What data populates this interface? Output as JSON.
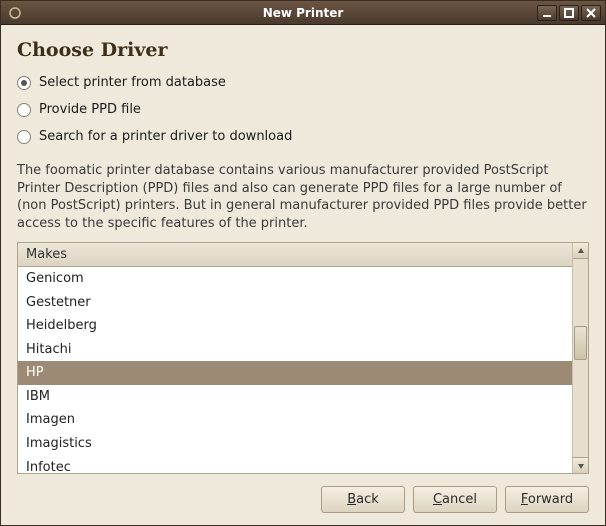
{
  "window": {
    "title": "New Printer"
  },
  "page": {
    "heading": "Choose Driver",
    "radios": [
      {
        "label": "Select printer from database",
        "checked": true
      },
      {
        "label": "Provide PPD file",
        "checked": false
      },
      {
        "label": "Search for a printer driver to download",
        "checked": false
      }
    ],
    "description": "The foomatic printer database contains various manufacturer provided PostScript Printer Description (PPD) files and also can generate PPD files for a large number of (non PostScript) printers. But in general manufacturer provided PPD files provide better access to the specific features of the printer."
  },
  "list": {
    "header": "Makes",
    "items": [
      "Genicom",
      "Gestetner",
      "Heidelberg",
      "Hitachi",
      "HP",
      "IBM",
      "Imagen",
      "Imagistics",
      "Infotec"
    ],
    "selected": "HP"
  },
  "buttons": {
    "back": "Back",
    "cancel": "Cancel",
    "forward": "Forward"
  }
}
